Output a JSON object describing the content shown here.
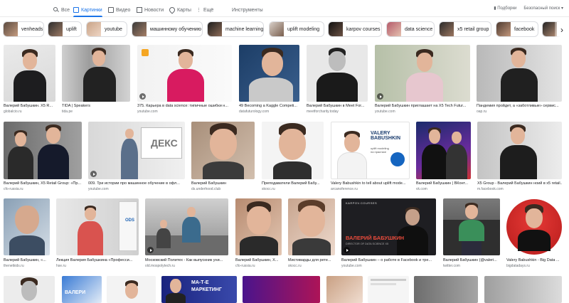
{
  "nav": {
    "tabs": [
      {
        "label": "Все",
        "icon": "search-icon"
      },
      {
        "label": "Картинки",
        "icon": "image-icon",
        "active": true
      },
      {
        "label": "Видео",
        "icon": "video-icon"
      },
      {
        "label": "Новости",
        "icon": "news-icon"
      },
      {
        "label": "Карты",
        "icon": "map-pin-icon"
      },
      {
        "label": "Ещё",
        "icon": "more-icon"
      }
    ],
    "tools": "Инструменты",
    "collections": "Подборки",
    "safesearch": "Безопасный поиск",
    "accent": "#1a73e8"
  },
  "chips": [
    "venheads",
    "uplift",
    "youtube",
    "машинному обучению",
    "machine learning",
    "uplift modeling",
    "karpov courses",
    "data science",
    "x5 retail group",
    "facebook"
  ],
  "rows": [
    [
      {
        "caption": "Валерий Бабушкин. X5 R...",
        "source": "globalcio.ru"
      },
      {
        "caption": "TIDA | Speakers",
        "source": "tida.pe"
      },
      {
        "caption": "375. Карьера в data science: типичные ошибки н...",
        "source": "youtube.com"
      },
      {
        "caption": "49 Becoming a Kaggle Competi...",
        "source": "datafuturology.com"
      },
      {
        "caption": "Валерий Бабушкин в Meet For...",
        "source": "meetforcharity.today"
      },
      {
        "caption": "Валерий Бабушкин приглашает на X5 Tech Futur...",
        "source": "youtube.com"
      },
      {
        "caption": "Пандемия пройдет, а «заботливые» сервис...",
        "source": "oap.ru"
      }
    ],
    [
      {
        "caption": "Валерий Бабушкин, X5 Retail Group: «Пр...",
        "source": "cfo-russia.ru"
      },
      {
        "caption": "009. Три истории про машинное обучение в офл...",
        "source": "youtube.com"
      },
      {
        "caption": "Валерий Бабушкин",
        "source": "ds.underhood.club"
      },
      {
        "caption": "Преподаватели Валерий Бабу...",
        "source": "skocc.ru"
      },
      {
        "caption": "Valery Babushkin to tell about uplift mode...",
        "source": "arcanoference.ru"
      },
      {
        "caption": "Валерий Бабушкин | ВКонт...",
        "source": "vk.com"
      },
      {
        "caption": "X5 Group - Валерий Бабушкин ноий в x5 retail...",
        "source": "m.facebook.com"
      }
    ],
    [
      {
        "caption": "Валерий Бабушкин, «...",
        "source": "thenetkids.ru"
      },
      {
        "caption": "Лекция Валерия Бабушкина «Професси...",
        "source": "hse.ru"
      },
      {
        "caption": "Московский Политех - Как выпускник уни...",
        "source": "old.mospolytech.ru"
      },
      {
        "caption": "Валерий Бабушкин, X...",
        "source": "cfo-russia.ru"
      },
      {
        "caption": "Мистиварды для рете...",
        "source": "skocc.ru"
      },
      {
        "caption": "Валерий Бабушкин – о работе в Facebook и тре...",
        "source": "youtube.com"
      },
      {
        "caption": "Валерий Бабушкин (@valeri...",
        "source": "twitter.com"
      },
      {
        "caption": "Valery Babushkin - Big Data ...",
        "source": "bigdatadays.ru"
      }
    ]
  ],
  "overlays": {
    "ods": "ODS",
    "valery": "VALERY",
    "babushkin": "BABUSHKIN",
    "uplift_note": "uplift modeling\nна практике",
    "valery_ru": "ВАЛЕРИЙ БАБУШКИН",
    "valery_role": "DIRECTOR OF DATA SCIENCE X5",
    "karpov": "KARPOV.COURSES",
    "matematika": "МА-Т-Е",
    "marketing": "МАРКЕТИНГ",
    "valery_ru_short": "ВАЛЕРИ"
  }
}
